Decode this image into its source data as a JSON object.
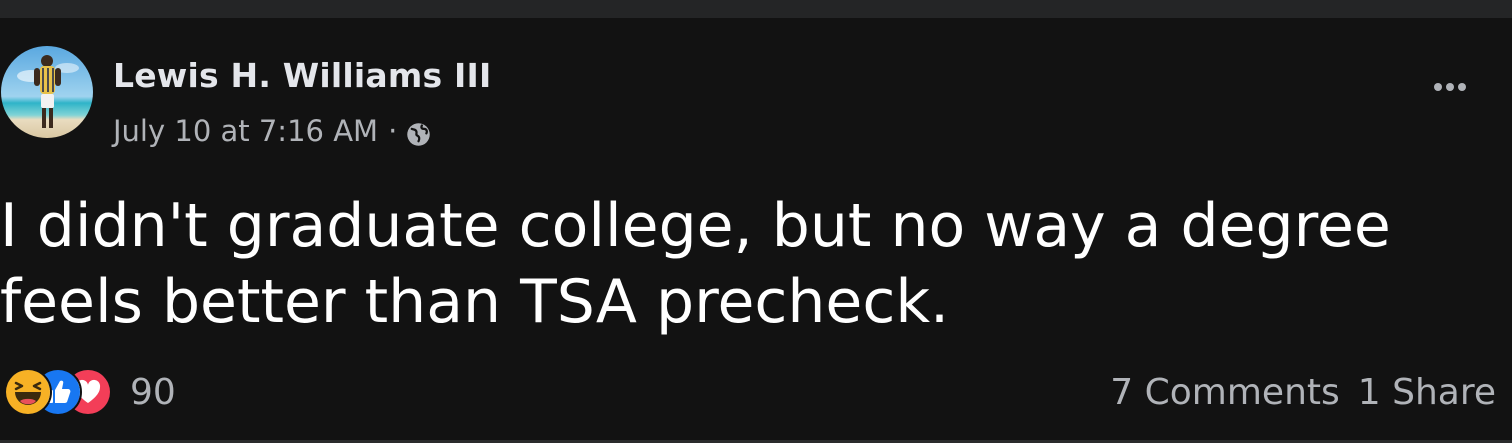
{
  "post": {
    "author": "Lewis H. Williams III",
    "timestamp": "July 10 at 7:16 AM",
    "separator": "·",
    "privacy_icon": "globe-icon",
    "more_icon": "more-options-icon",
    "text": "I didn't graduate college, but no way a degree feels better than TSA precheck."
  },
  "reactions": {
    "types": [
      "haha",
      "like",
      "love"
    ],
    "count": "90"
  },
  "engagement": {
    "comments": "7 Comments",
    "shares": "1 Share"
  },
  "colors": {
    "background": "#121212",
    "primary_text": "#e4e6eb",
    "secondary_text": "#b0b3b8",
    "like_blue": "#1877f2",
    "love_red": "#f33e58",
    "haha_yellow": "#f7b125"
  }
}
